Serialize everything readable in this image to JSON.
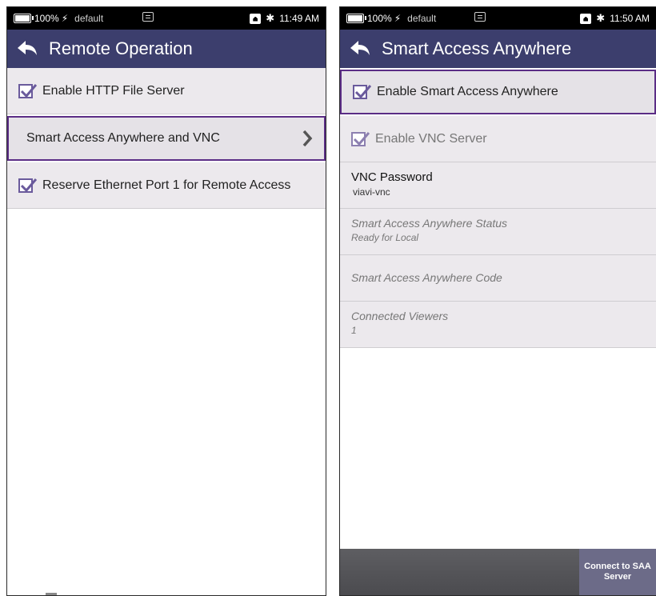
{
  "left": {
    "status": {
      "battery": "100%",
      "profile": "default",
      "time": "11:49 AM"
    },
    "title": "Remote Operation",
    "items": [
      {
        "label": "Enable HTTP File Server",
        "checked": true
      },
      {
        "label": "Smart Access Anywhere and VNC",
        "selected": true
      },
      {
        "label": "Reserve Ethernet Port 1 for Remote Access",
        "checked": true
      }
    ]
  },
  "right": {
    "status": {
      "battery": "100%",
      "profile": "default",
      "time": "11:50 AM"
    },
    "title": "Smart Access Anywhere",
    "items": [
      {
        "label": "Enable Smart Access Anywhere",
        "checked": true,
        "selected": true
      },
      {
        "label": "Enable VNC Server",
        "checked": true,
        "disabled": true
      }
    ],
    "fields": [
      {
        "label": "VNC Password",
        "value": "viavi-vnc"
      },
      {
        "label": "Smart Access Anywhere Status",
        "value": "Ready for Local"
      },
      {
        "label": "Smart Access Anywhere Code",
        "value": ""
      },
      {
        "label": "Connected Viewers",
        "value": "1"
      }
    ],
    "connect_button": "Connect to SAA Server"
  },
  "colors": {
    "title_bar": "#3c3e6d",
    "accent": "#5b2d86",
    "list_bg": "#ece9ed",
    "checkbox": "#6a5a9c"
  }
}
